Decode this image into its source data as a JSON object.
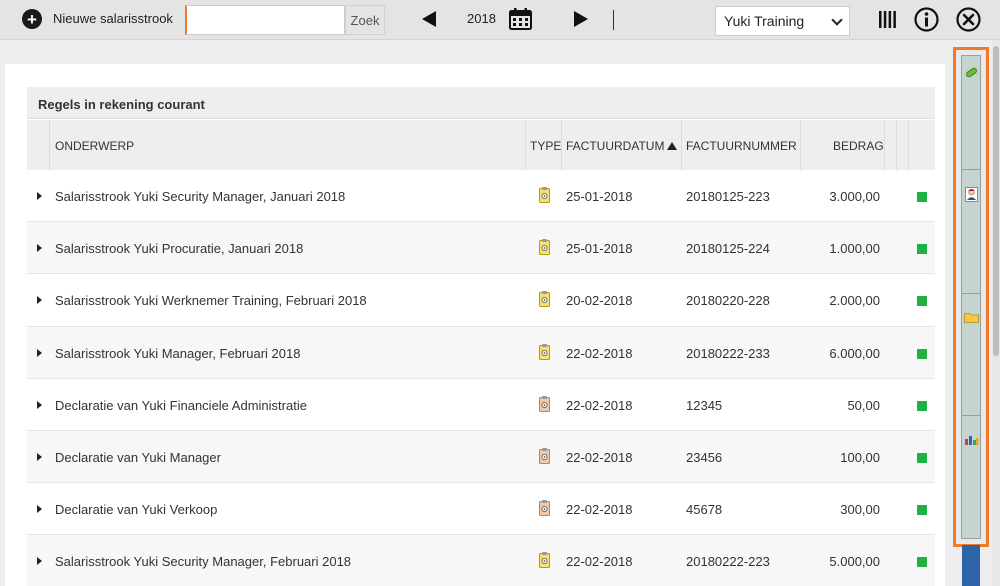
{
  "toolbar": {
    "new_label": "Nieuwe salarisstrook",
    "search_value": "",
    "search_placeholder": "",
    "search_button": "Zoek",
    "year": "2018",
    "administration": "Yuki Training",
    "icons": {
      "add": "plus-circle-icon",
      "prev": "triangle-left-icon",
      "calendar": "calendar-icon",
      "next": "triangle-right-icon",
      "columns": "columns-icon",
      "info": "info-icon",
      "close": "close-circle-icon"
    }
  },
  "section": {
    "title": "Regels in rekening courant"
  },
  "table": {
    "columns": {
      "subject": "ONDERWERP",
      "type": "TYPE",
      "invoice_date": "FACTUURDATUM",
      "invoice_number": "FACTUURNUMMER",
      "amount": "BEDRAG"
    },
    "sort_column": "invoice_date",
    "sort_direction": "ascending",
    "rows": [
      {
        "subject": "Salarisstrook Yuki Security Manager, Januari 2018",
        "type": "payslip",
        "date": "25-01-2018",
        "number": "20180125-223",
        "amount": "3.000,00",
        "status": "green"
      },
      {
        "subject": "Salarisstrook Yuki Procuratie, Januari 2018",
        "type": "payslip",
        "date": "25-01-2018",
        "number": "20180125-224",
        "amount": "1.000,00",
        "status": "green"
      },
      {
        "subject": "Salarisstrook Yuki Werknemer Training, Februari 2018",
        "type": "payslip",
        "date": "20-02-2018",
        "number": "20180220-228",
        "amount": "2.000,00",
        "status": "green"
      },
      {
        "subject": "Salarisstrook Yuki Manager, Februari 2018",
        "type": "payslip",
        "date": "22-02-2018",
        "number": "20180222-233",
        "amount": "6.000,00",
        "status": "green"
      },
      {
        "subject": "Declaratie van Yuki Financiele Administratie",
        "type": "expense",
        "date": "22-02-2018",
        "number": "12345",
        "amount": "50,00",
        "status": "green"
      },
      {
        "subject": "Declaratie van Yuki Manager",
        "type": "expense",
        "date": "22-02-2018",
        "number": "23456",
        "amount": "100,00",
        "status": "green"
      },
      {
        "subject": "Declaratie van Yuki Verkoop",
        "type": "expense",
        "date": "22-02-2018",
        "number": "45678",
        "amount": "300,00",
        "status": "green"
      },
      {
        "subject": "Salarisstrook Yuki Security Manager, Februari 2018",
        "type": "payslip",
        "date": "22-02-2018",
        "number": "20180222-223",
        "amount": "5.000,00",
        "status": "green"
      }
    ]
  },
  "side_strip": {
    "items": [
      "paperclip-icon",
      "person-icon",
      "folder-icon",
      "chart-icon"
    ]
  },
  "colors": {
    "accent": "#f07a2a",
    "status_green": "#1fb141",
    "strip_fill": "#c6d4cf"
  }
}
